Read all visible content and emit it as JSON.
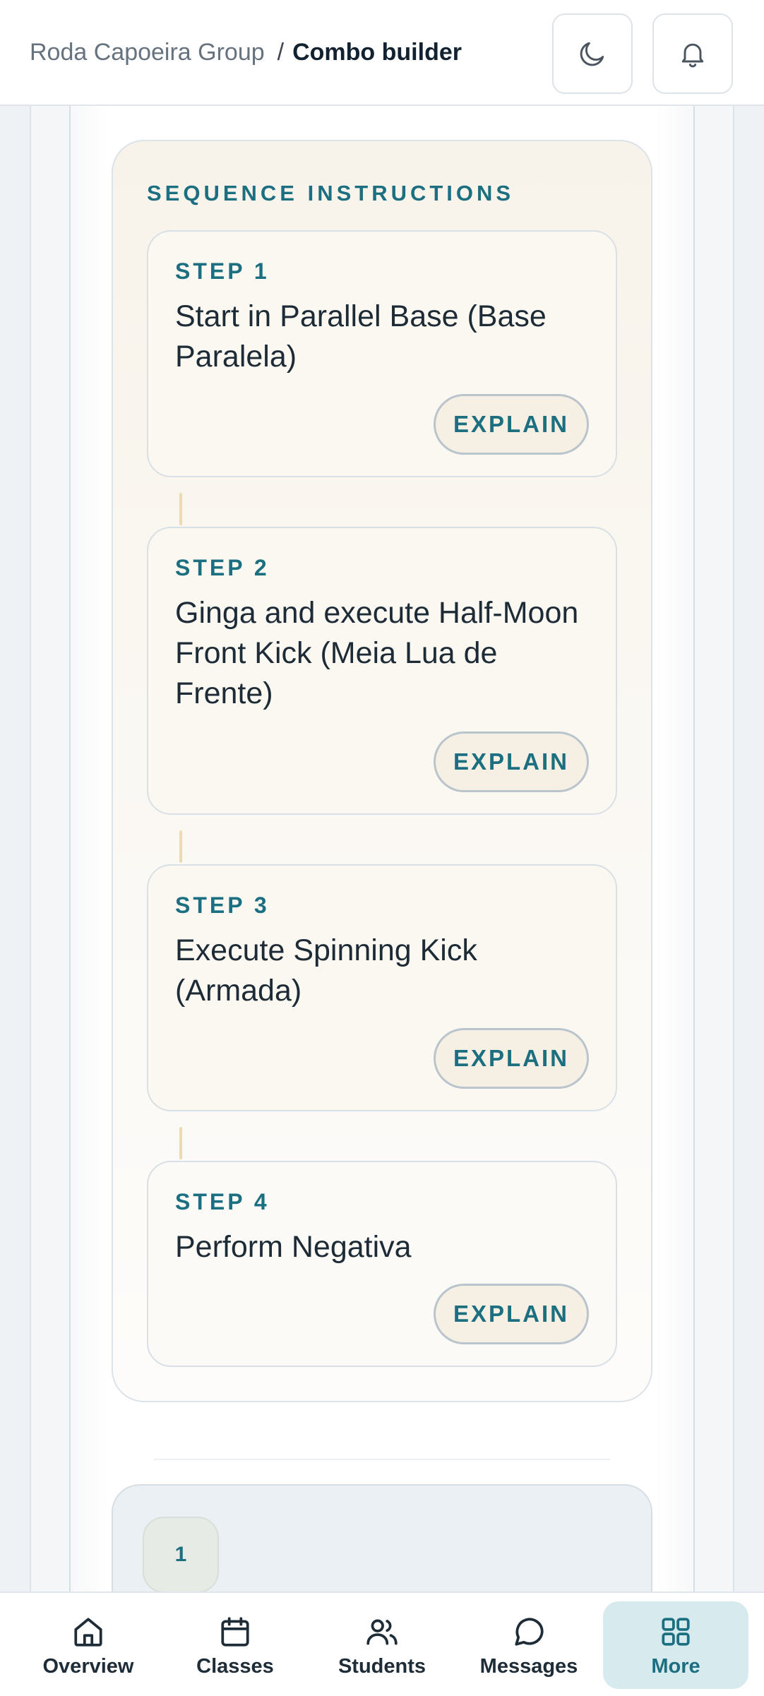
{
  "header": {
    "breadcrumb_parent": "Roda Capoeira Group",
    "breadcrumb_separator": "/",
    "breadcrumb_current": "Combo builder",
    "theme_button_icon": "moon-icon",
    "notification_button_icon": "bell-icon"
  },
  "sequence": {
    "title": "SEQUENCE INSTRUCTIONS",
    "explain_label": "EXPLAIN",
    "steps": [
      {
        "label": "STEP 1",
        "text": "Start in Parallel Base (Base Paralela)"
      },
      {
        "label": "STEP 2",
        "text": "Ginga and execute Half-Moon Front Kick (Meia Lua de Frente)"
      },
      {
        "label": "STEP 3",
        "text": "Execute Spinning Kick (Armada)"
      },
      {
        "label": "STEP 4",
        "text": "Perform Negativa"
      }
    ]
  },
  "next_section": {
    "counter": "1"
  },
  "bottom_nav": {
    "items": [
      {
        "label": "Overview",
        "icon": "home-icon"
      },
      {
        "label": "Classes",
        "icon": "calendar-icon"
      },
      {
        "label": "Students",
        "icon": "users-icon"
      },
      {
        "label": "Messages",
        "icon": "message-circle-icon"
      },
      {
        "label": "More",
        "icon": "grid-icon",
        "active": true
      }
    ]
  },
  "colors": {
    "accent": "#1c6f80",
    "active_nav_bg": "#d7ebef",
    "card_bg": "#f8f3ea"
  }
}
